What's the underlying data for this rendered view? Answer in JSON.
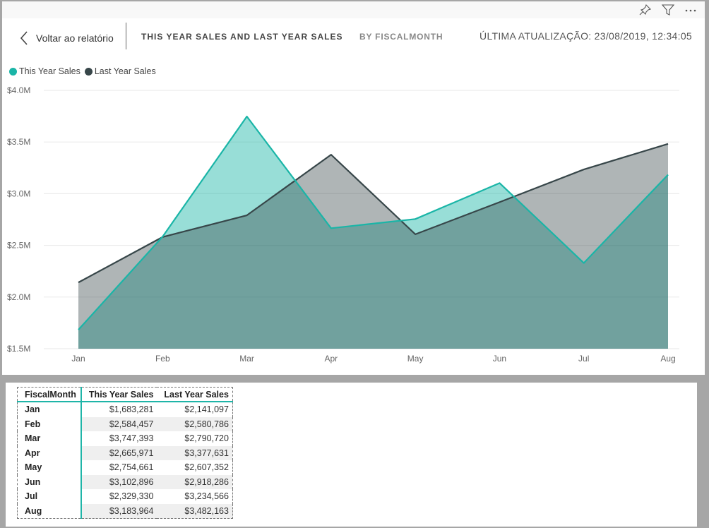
{
  "toolbar": {
    "icons": [
      "pin-icon",
      "filter-icon",
      "more-options-icon"
    ]
  },
  "header": {
    "back_label": "Voltar ao relatório",
    "title": "THIS YEAR SALES AND LAST YEAR SALES",
    "subtitle": "BY FISCALMONTH",
    "last_updated": "ÚLTIMA ATUALIZAÇÃO: 23/08/2019, 12:34:05"
  },
  "colors": {
    "this_year": "#1ab5a7",
    "last_year": "#374649",
    "this_year_fill": "#8fe0d8",
    "last_year_fill": "#9ea3a6",
    "overlap_fill": "#71a3a0",
    "table_accent": "#1fb5a8"
  },
  "chart_data": {
    "type": "area",
    "title": "This Year Sales and Last Year Sales by FiscalMonth",
    "xlabel": "",
    "ylabel": "",
    "categories": [
      "Jan",
      "Feb",
      "Mar",
      "Apr",
      "May",
      "Jun",
      "Jul",
      "Aug"
    ],
    "series": [
      {
        "name": "This Year Sales",
        "values": [
          1683281,
          2584457,
          3747393,
          2665971,
          2754661,
          3102896,
          2329330,
          3183964
        ]
      },
      {
        "name": "Last Year Sales",
        "values": [
          2141097,
          2580786,
          2790720,
          3377631,
          2607352,
          2918286,
          3234566,
          3482163
        ]
      }
    ],
    "ylim": [
      1500000,
      4000000
    ],
    "yticks": [
      1500000,
      2000000,
      2500000,
      3000000,
      3500000,
      4000000
    ],
    "ytick_labels": [
      "$1.5M",
      "$2.0M",
      "$2.5M",
      "$3.0M",
      "$3.5M",
      "$4.0M"
    ],
    "grid": true,
    "legend": "top-left"
  },
  "table": {
    "columns": [
      "FiscalMonth",
      "This Year Sales",
      "Last Year Sales"
    ],
    "rows": [
      [
        "Jan",
        "$1,683,281",
        "$2,141,097"
      ],
      [
        "Feb",
        "$2,584,457",
        "$2,580,786"
      ],
      [
        "Mar",
        "$3,747,393",
        "$2,790,720"
      ],
      [
        "Apr",
        "$2,665,971",
        "$3,377,631"
      ],
      [
        "May",
        "$2,754,661",
        "$2,607,352"
      ],
      [
        "Jun",
        "$3,102,896",
        "$2,918,286"
      ],
      [
        "Jul",
        "$2,329,330",
        "$3,234,566"
      ],
      [
        "Aug",
        "$3,183,964",
        "$3,482,163"
      ]
    ]
  }
}
